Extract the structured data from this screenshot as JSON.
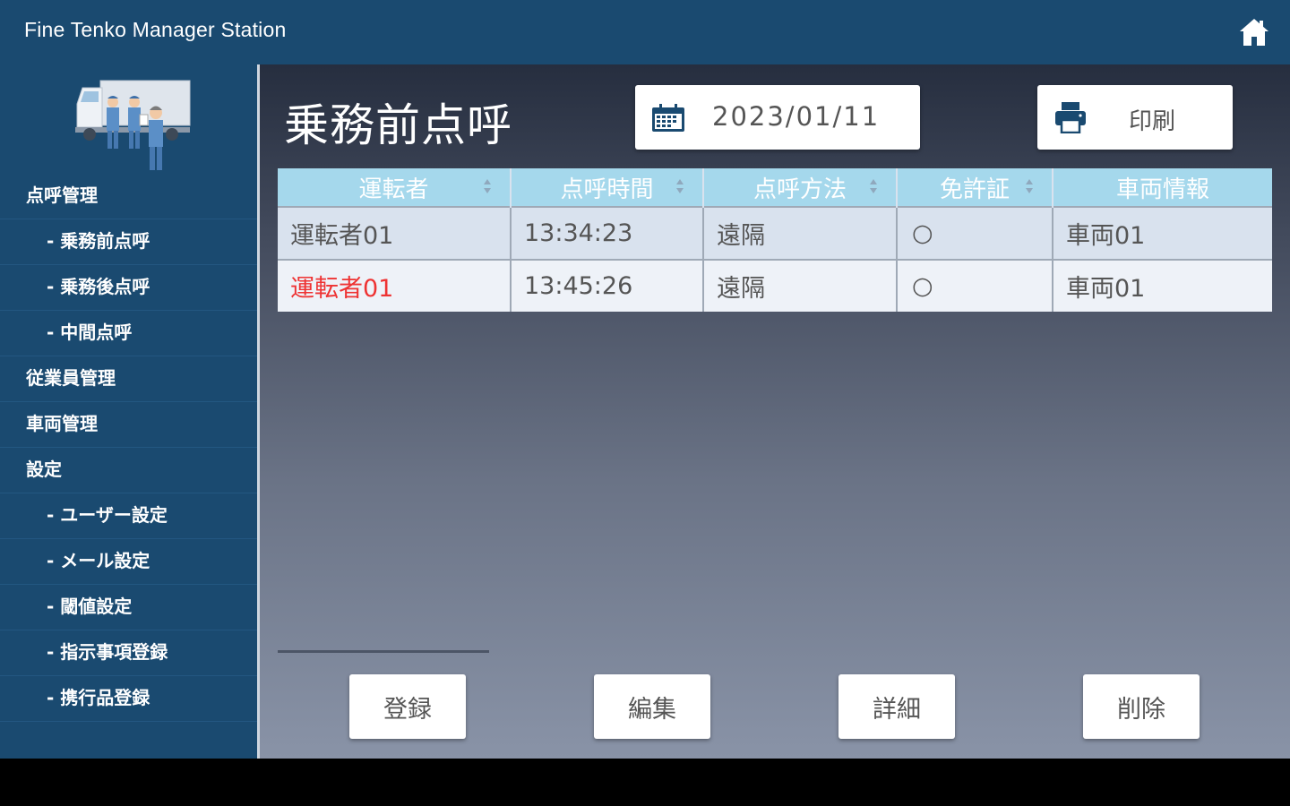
{
  "app": {
    "title": "Fine Tenko Manager Station"
  },
  "sidebar": {
    "items": [
      {
        "label": "点呼管理",
        "level": 1
      },
      {
        "label": "- 乗務前点呼",
        "level": 2
      },
      {
        "label": "- 乗務後点呼",
        "level": 2
      },
      {
        "label": "- 中間点呼",
        "level": 2
      },
      {
        "label": "従業員管理",
        "level": 1
      },
      {
        "label": "車両管理",
        "level": 1
      },
      {
        "label": "設定",
        "level": 1
      },
      {
        "label": "- ユーザー設定",
        "level": 2
      },
      {
        "label": "- メール設定",
        "level": 2
      },
      {
        "label": "- 閾値設定",
        "level": 2
      },
      {
        "label": "- 指示事項登録",
        "level": 2
      },
      {
        "label": "- 携行品登録",
        "level": 2
      }
    ]
  },
  "main": {
    "title": "乗務前点呼",
    "date": "2023/01/11",
    "print_label": "印刷"
  },
  "table": {
    "headers": [
      "運転者",
      "点呼時間",
      "点呼方法",
      "免許証",
      "車両情報"
    ],
    "rows": [
      {
        "driver": "運転者01",
        "time": "13:34:23",
        "method": "遠隔",
        "license": "○",
        "vehicle": "車両01"
      },
      {
        "driver": "運転者01",
        "time": "13:45:26",
        "method": "遠隔",
        "license": "○",
        "vehicle": "車両01"
      }
    ]
  },
  "actions": {
    "register": "登録",
    "edit": "編集",
    "detail": "詳細",
    "delete": "削除"
  },
  "colors": {
    "header_bar": "#1a4a70",
    "table_header": "#a5d8ec",
    "alert_text": "#ee3333"
  }
}
